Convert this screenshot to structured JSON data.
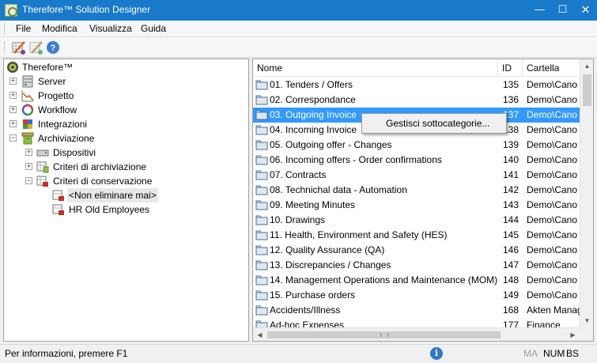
{
  "window": {
    "title": "Therefore™ Solution Designer",
    "minimize_glyph": "—",
    "maximize_glyph": "☐",
    "close_glyph": "✕"
  },
  "menu": [
    "File",
    "Modifica",
    "Visualizza",
    "Guida"
  ],
  "toolbar": {
    "buttons": [
      "pencil-grid-icon",
      "pencil-grid-disabled-icon",
      "help-icon"
    ],
    "help_glyph": "?"
  },
  "tree": {
    "root": "Therefore™",
    "items": [
      {
        "label": "Server",
        "expander": "+"
      },
      {
        "label": "Progetto",
        "expander": "+"
      },
      {
        "label": "Workflow",
        "expander": "+"
      },
      {
        "label": "Integrazioni",
        "expander": "+"
      },
      {
        "label": "Archiviazione",
        "expander": "−"
      },
      {
        "label": "Dispositivi",
        "expander": "+"
      },
      {
        "label": "Criteri di archiviazione",
        "expander": "+"
      },
      {
        "label": "Criteri di conservazione",
        "expander": "−"
      },
      {
        "label": "<Non eliminare mai>",
        "selected": true
      },
      {
        "label": "HR Old Employees"
      }
    ]
  },
  "list": {
    "columns": [
      "Nome",
      "ID",
      "Cartella"
    ],
    "rows": [
      {
        "name": "01. Tenders / Offers",
        "id": "135",
        "folder": "Demo\\Cano"
      },
      {
        "name": "02. Correspondance",
        "id": "136",
        "folder": "Demo\\Cano"
      },
      {
        "name": "03. Outgoing Invoice",
        "id": "137",
        "folder": "Demo\\Cano"
      },
      {
        "name": "04. Incoming Invoice",
        "id": "138",
        "folder": "Demo\\Cano"
      },
      {
        "name": "05. Outgoing offer - Changes",
        "id": "139",
        "folder": "Demo\\Cano"
      },
      {
        "name": "06. Incoming offers - Order confirmations",
        "id": "140",
        "folder": "Demo\\Cano"
      },
      {
        "name": "07. Contracts",
        "id": "141",
        "folder": "Demo\\Cano"
      },
      {
        "name": "08. Technichal data - Automation",
        "id": "142",
        "folder": "Demo\\Cano"
      },
      {
        "name": "09. Meeting Minutes",
        "id": "143",
        "folder": "Demo\\Cano"
      },
      {
        "name": "10. Drawings",
        "id": "144",
        "folder": "Demo\\Cano"
      },
      {
        "name": "11. Health, Environment and Safety (HES)",
        "id": "145",
        "folder": "Demo\\Cano"
      },
      {
        "name": "12. Quality Assurance (QA)",
        "id": "146",
        "folder": "Demo\\Cano"
      },
      {
        "name": "13. Discrepancies / Changes",
        "id": "147",
        "folder": "Demo\\Cano"
      },
      {
        "name": "14. Management Operations and Maintenance (MOM)",
        "id": "148",
        "folder": "Demo\\Cano"
      },
      {
        "name": "15. Purchase orders",
        "id": "149",
        "folder": "Demo\\Cano"
      },
      {
        "name": "Accidents/Illness",
        "id": "168",
        "folder": "Akten Manag"
      },
      {
        "name": "Ad-hoc Expenses",
        "id": "177",
        "folder": "Finance"
      }
    ],
    "highlighted_row": 2
  },
  "context_menu": {
    "item": "Gestisci sottocategorie..."
  },
  "scroll": {
    "up": "▲",
    "down": "▼",
    "left": "◀",
    "right": "▶"
  },
  "status": {
    "text": "Per informazioni, premere F1",
    "info_glyph": "i",
    "indicators": [
      "MA",
      "NUM",
      "BS"
    ]
  },
  "colors": {
    "titlebar": "#1979ca",
    "selection": "#3399ff"
  }
}
